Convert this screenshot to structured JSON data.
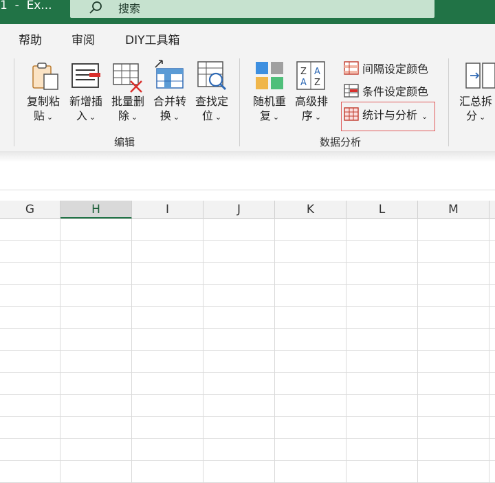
{
  "titlebar": {
    "title": "1  -  Ex...",
    "search_label": "搜索"
  },
  "menu": {
    "items": [
      "帮助",
      "审阅",
      "DIY工具箱"
    ]
  },
  "ribbon": {
    "group_edit": {
      "label": "编辑",
      "buttons": [
        {
          "line1": "复制粘",
          "line2": "贴"
        },
        {
          "line1": "新增插",
          "line2": "入"
        },
        {
          "line1": "批量删",
          "line2": "除"
        },
        {
          "line1": "合并转",
          "line2": "换"
        },
        {
          "line1": "查找定",
          "line2": "位"
        }
      ]
    },
    "group_data": {
      "label": "数据分析",
      "buttons": [
        {
          "line1": "随机重",
          "line2": "复"
        },
        {
          "line1": "高级排",
          "line2": "序"
        }
      ],
      "small_buttons": [
        "间隔设定颜色",
        "条件设定颜色",
        "统计与分析"
      ]
    },
    "group_next": {
      "buttons": [
        {
          "line1": "汇总拆",
          "line2": "分"
        }
      ]
    },
    "chevron": "⌄"
  },
  "sheet": {
    "columns": [
      "G",
      "H",
      "I",
      "J",
      "K",
      "L",
      "M"
    ],
    "active_column": "H"
  },
  "colors": {
    "title_green": "#217346",
    "highlight_red": "#e05a5a"
  }
}
